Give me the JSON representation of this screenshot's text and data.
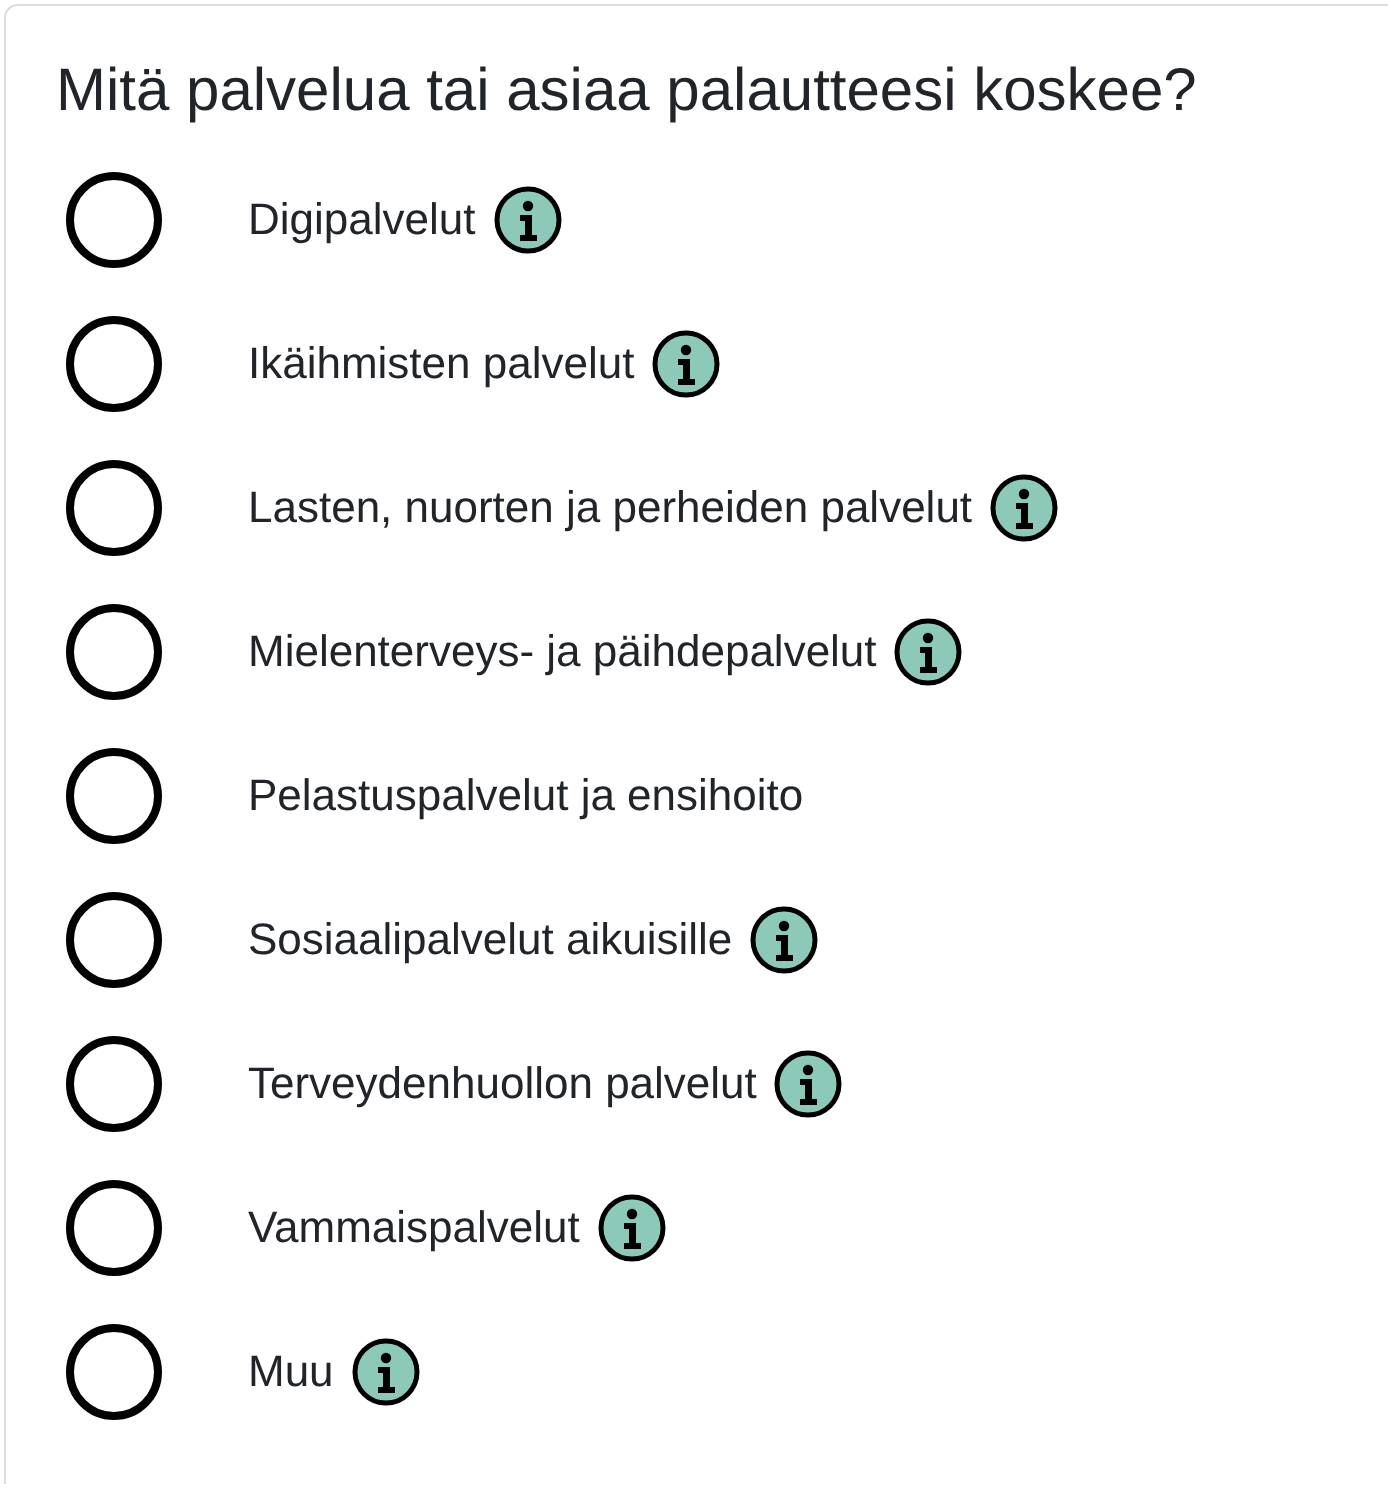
{
  "question": "Mitä palvelua tai asiaa palautteesi koskee?",
  "options": [
    {
      "label": "Digipalvelut",
      "selected": false,
      "info": true
    },
    {
      "label": "Ikäihmisten palvelut",
      "selected": false,
      "info": true
    },
    {
      "label": "Lasten, nuorten ja perheiden palvelut",
      "selected": false,
      "info": true
    },
    {
      "label": "Mielenterveys- ja päihdepalvelut",
      "selected": false,
      "info": true
    },
    {
      "label": "Pelastuspalvelut ja ensihoito",
      "selected": false,
      "info": false
    },
    {
      "label": "Sosiaalipalvelut aikuisille",
      "selected": false,
      "info": true
    },
    {
      "label": "Terveydenhuollon palvelut",
      "selected": false,
      "info": true
    },
    {
      "label": "Vammaispalvelut",
      "selected": false,
      "info": true
    },
    {
      "label": "Muu",
      "selected": false,
      "info": true
    }
  ]
}
